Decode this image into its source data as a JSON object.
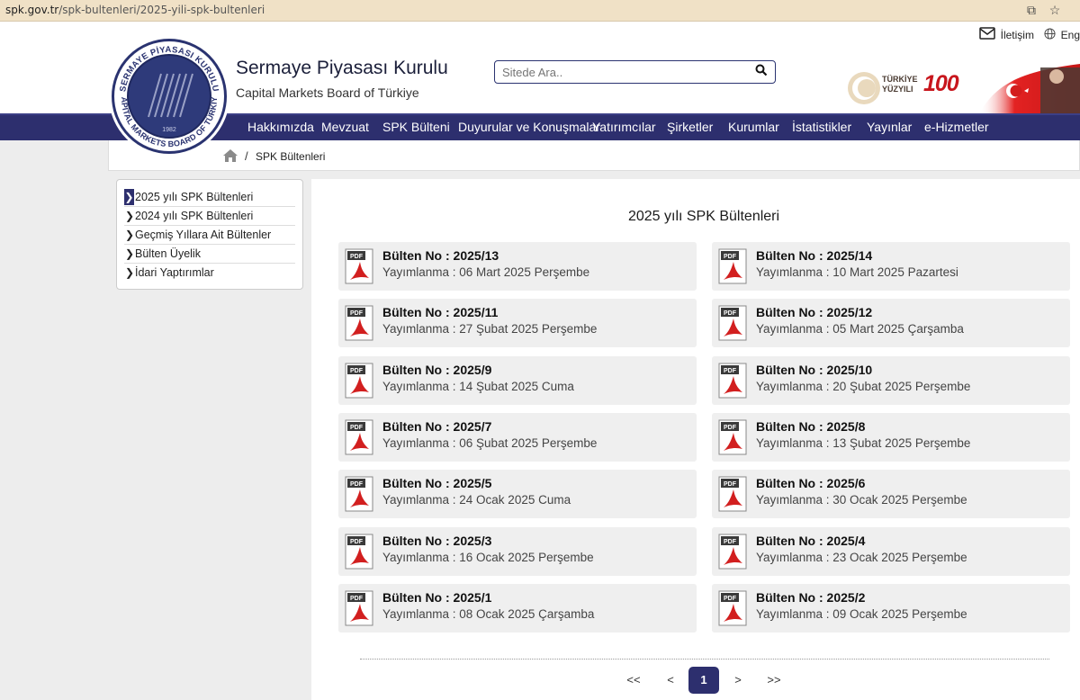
{
  "browser": {
    "url_domain": "spk.gov.tr",
    "url_path": "/spk-bultenleri/2025-yili-spk-bultenleri"
  },
  "header": {
    "contact_label": "İletişim",
    "lang_label": "Eng",
    "org_name": "Sermaye Piyasası Kurulu",
    "org_sub": "Capital Markets Board of Türkiye",
    "logo_ring_top": "SERMAYE PİYASASI KURULU",
    "logo_ring_bottom": "CAPITAL MARKETS BOARD OF TÜRKİYE",
    "logo_year": "1982",
    "badge_text_1": "TÜRKİYE",
    "badge_text_2": "YÜZYILI",
    "badge_number": "100",
    "search_placeholder": "Sitede Ara.."
  },
  "nav": [
    "Hakkımızda",
    "Mevzuat",
    "SPK Bülteni",
    "Duyurular ve Konuşmalar",
    "Yatırımcılar",
    "Şirketler",
    "Kurumlar",
    "İstatistikler",
    "Yayınlar",
    "e-Hizmetler"
  ],
  "breadcrumb": {
    "separator": "/",
    "current": "SPK Bültenleri"
  },
  "sidebar": [
    "2025 yılı SPK Bültenleri",
    "2024 yılı SPK Bültenleri",
    "Geçmiş Yıllara Ait Bültenler",
    "Bülten Üyelik",
    "İdari Yaptırımlar"
  ],
  "main": {
    "title": "2025 yılı SPK Bültenleri",
    "pdf_label": "PDF",
    "bulletins": [
      {
        "title": "Bülten No : 2025/13",
        "date": "Yayımlanma : 06 Mart 2025 Perşembe"
      },
      {
        "title": "Bülten No : 2025/14",
        "date": "Yayımlanma : 10 Mart 2025 Pazartesi"
      },
      {
        "title": "Bülten No : 2025/11",
        "date": "Yayımlanma : 27 Şubat 2025 Perşembe"
      },
      {
        "title": "Bülten No : 2025/12",
        "date": "Yayımlanma : 05 Mart 2025 Çarşamba"
      },
      {
        "title": "Bülten No : 2025/9",
        "date": "Yayımlanma : 14 Şubat 2025 Cuma"
      },
      {
        "title": "Bülten No : 2025/10",
        "date": "Yayımlanma : 20 Şubat 2025 Perşembe"
      },
      {
        "title": "Bülten No : 2025/7",
        "date": "Yayımlanma : 06 Şubat 2025 Perşembe"
      },
      {
        "title": "Bülten No : 2025/8",
        "date": "Yayımlanma : 13 Şubat 2025 Perşembe"
      },
      {
        "title": "Bülten No : 2025/5",
        "date": "Yayımlanma : 24 Ocak 2025 Cuma"
      },
      {
        "title": "Bülten No : 2025/6",
        "date": "Yayımlanma : 30 Ocak 2025 Perşembe"
      },
      {
        "title": "Bülten No : 2025/3",
        "date": "Yayımlanma : 16 Ocak 2025 Perşembe"
      },
      {
        "title": "Bülten No : 2025/4",
        "date": "Yayımlanma : 23 Ocak 2025 Perşembe"
      },
      {
        "title": "Bülten No : 2025/1",
        "date": "Yayımlanma : 08 Ocak 2025 Çarşamba"
      },
      {
        "title": "Bülten No : 2025/2",
        "date": "Yayımlanma : 09 Ocak 2025 Perşembe"
      }
    ]
  },
  "pagination": {
    "first": "<<",
    "prev": "<",
    "current": "1",
    "next": ">",
    "last": ">>"
  },
  "colors": {
    "nav_bg": "#2d2f6e",
    "card_bg": "#efefef",
    "pdf_red": "#d21f1f"
  }
}
